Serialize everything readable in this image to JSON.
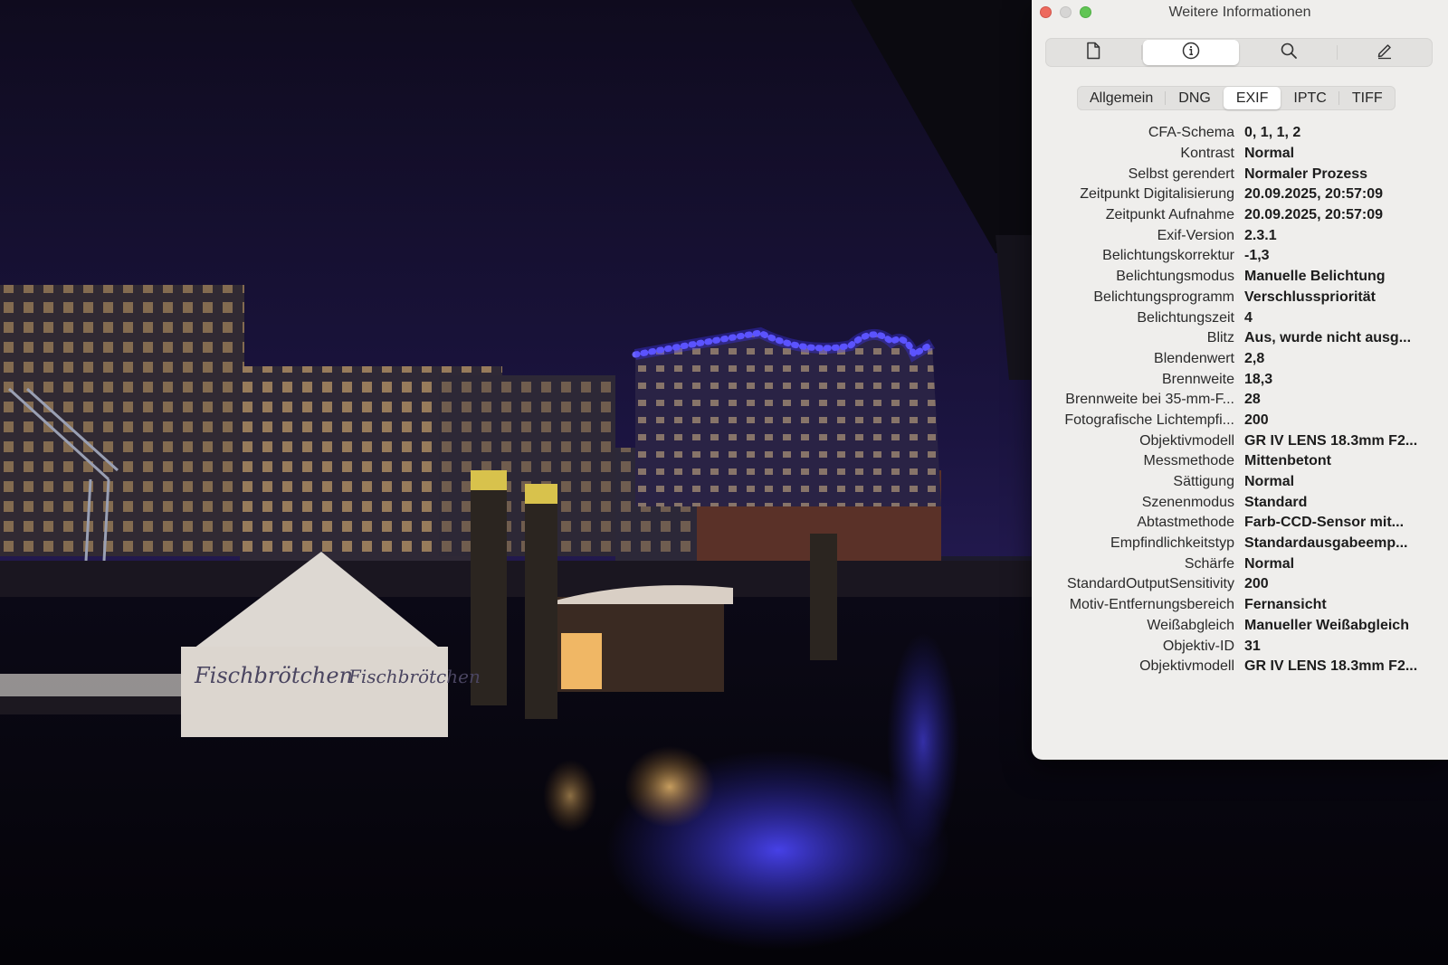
{
  "window": {
    "title": "Weitere Informationen"
  },
  "toolbar": {
    "items": [
      {
        "icon": "document-icon",
        "active": false
      },
      {
        "icon": "info-icon",
        "active": true
      },
      {
        "icon": "search-icon",
        "active": false
      },
      {
        "icon": "pencil-icon",
        "active": false
      }
    ]
  },
  "tabs": [
    "Allgemein",
    "DNG",
    "EXIF",
    "IPTC",
    "TIFF"
  ],
  "active_tab": "EXIF",
  "exif": [
    {
      "label": "CFA-Schema",
      "value": "0, 1, 1, 2"
    },
    {
      "label": "Kontrast",
      "value": "Normal"
    },
    {
      "label": "Selbst gerendert",
      "value": "Normaler Prozess"
    },
    {
      "label": "Zeitpunkt Digitalisierung",
      "value": "20.09.2025, 20:57:09"
    },
    {
      "label": "Zeitpunkt Aufnahme",
      "value": "20.09.2025, 20:57:09"
    },
    {
      "label": "Exif-Version",
      "value": "2.3.1"
    },
    {
      "label": "Belichtungskorrektur",
      "value": "-1,3"
    },
    {
      "label": "Belichtungsmodus",
      "value": "Manuelle Belichtung"
    },
    {
      "label": "Belichtungsprogramm",
      "value": "Verschlusspriorität"
    },
    {
      "label": "Belichtungszeit",
      "value": "4"
    },
    {
      "label": "Blitz",
      "value": "Aus, wurde nicht ausg..."
    },
    {
      "label": "Blendenwert",
      "value": "2,8"
    },
    {
      "label": "Brennweite",
      "value": "18,3"
    },
    {
      "label": "Brennweite bei 35-mm-F...",
      "value": "28"
    },
    {
      "label": "Fotografische Lichtempfi...",
      "value": "200"
    },
    {
      "label": "Objektivmodell",
      "value": "GR IV LENS 18.3mm F2..."
    },
    {
      "label": "Messmethode",
      "value": "Mittenbetont"
    },
    {
      "label": "Sättigung",
      "value": "Normal"
    },
    {
      "label": "Szenenmodus",
      "value": "Standard"
    },
    {
      "label": "Abtastmethode",
      "value": "Farb-CCD-Sensor mit..."
    },
    {
      "label": "Empfindlichkeitstyp",
      "value": "Standardausgabeemp..."
    },
    {
      "label": "Schärfe",
      "value": "Normal"
    },
    {
      "label": "StandardOutputSensitivity",
      "value": "200"
    },
    {
      "label": "Motiv-Entfernungsbereich",
      "value": "Fernansicht"
    },
    {
      "label": "Weißabgleich",
      "value": "Manueller Weißabgleich"
    },
    {
      "label": "Objektiv-ID",
      "value": "31"
    },
    {
      "label": "Objektivmodell",
      "value": "GR IV LENS 18.3mm F2..."
    }
  ],
  "photo": {
    "tent_text": [
      "Fischbrötchen",
      "Fischbrötchen"
    ],
    "colors": {
      "sky": "#120d2c",
      "accent_blue": "#4a44ff",
      "window_warm": "#f2c27a"
    }
  }
}
